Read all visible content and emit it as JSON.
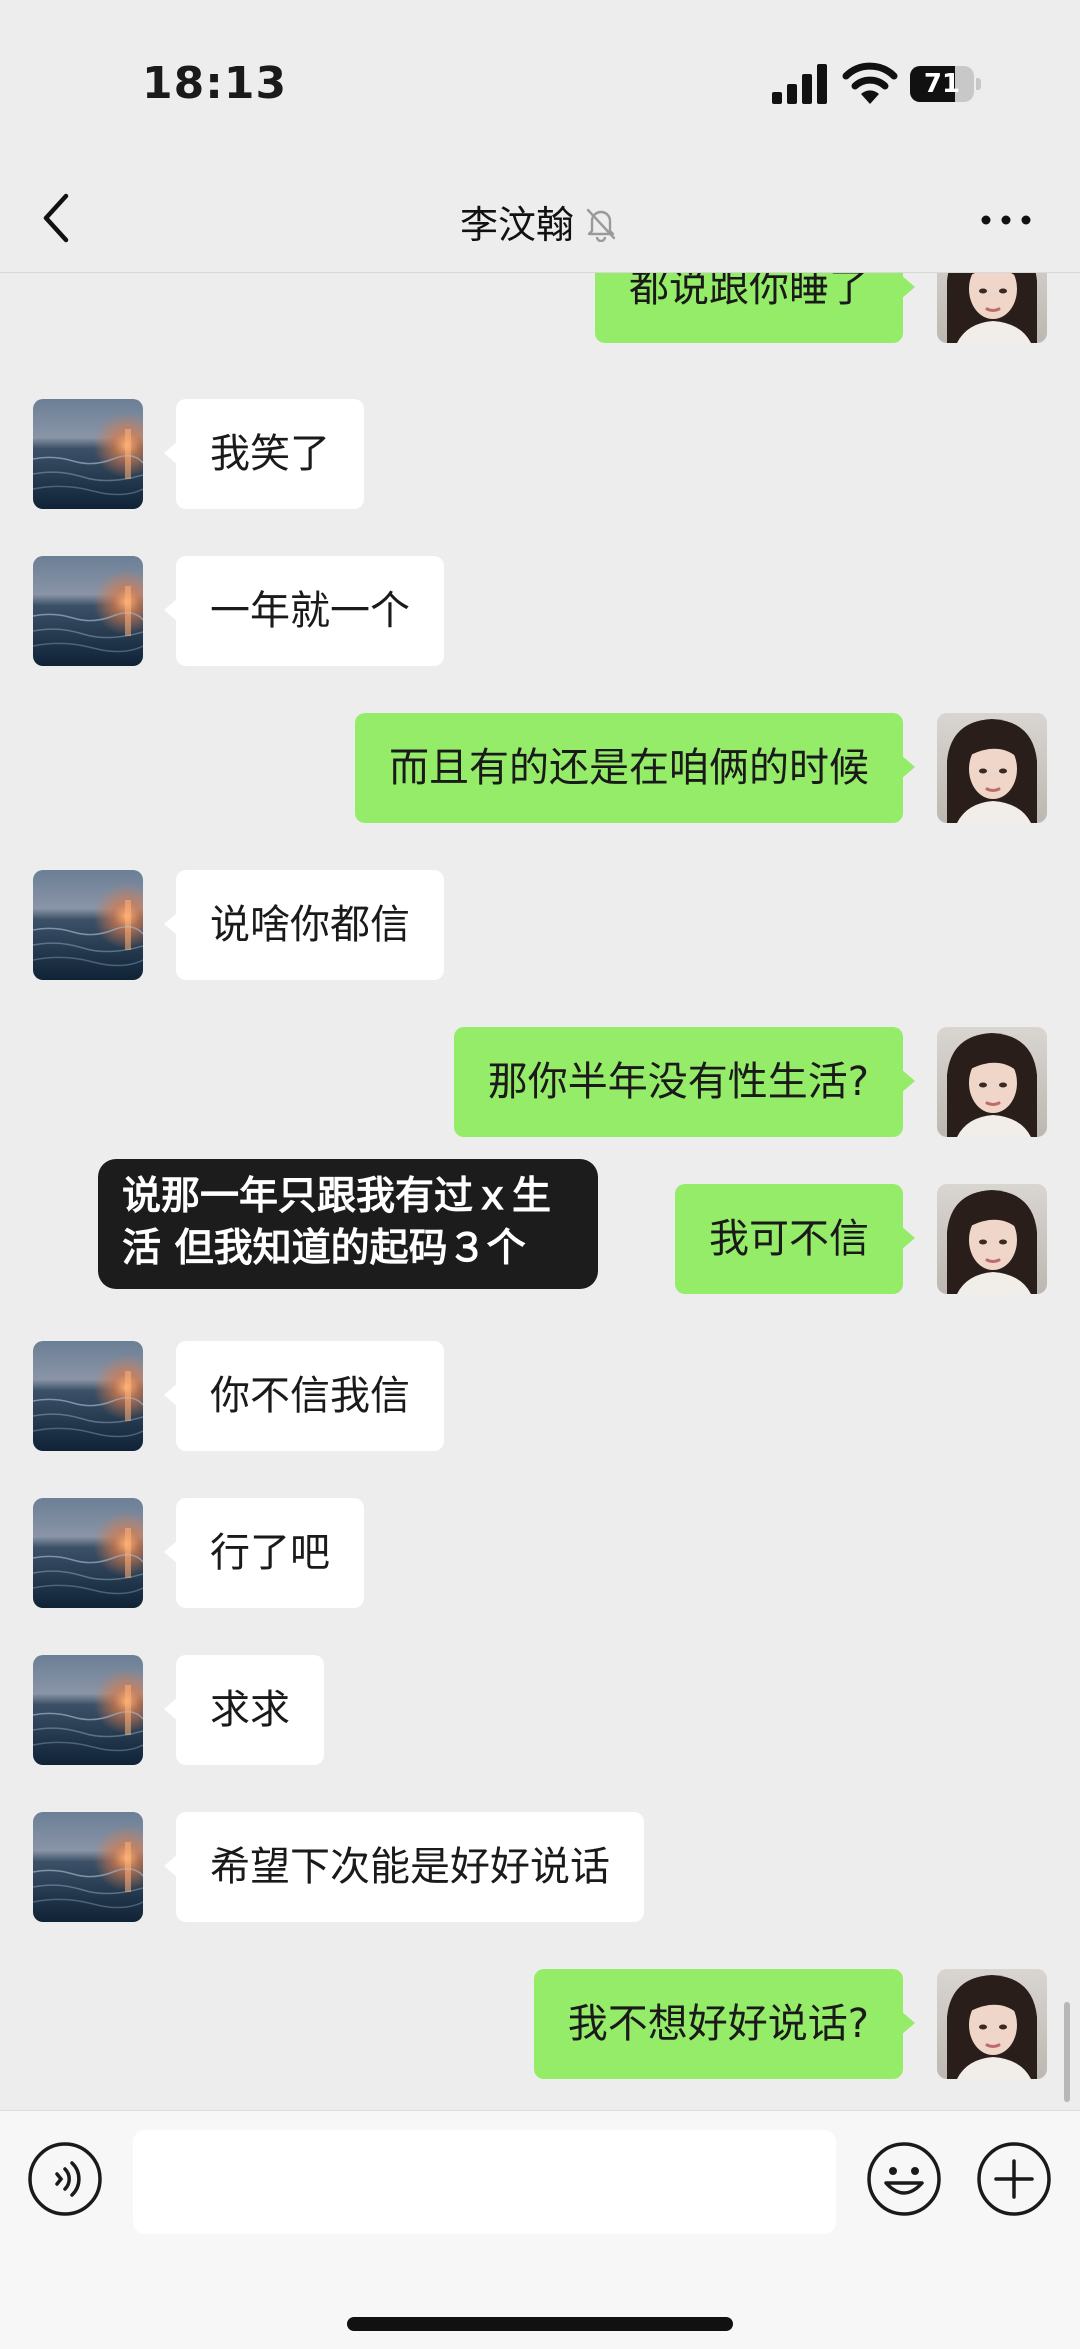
{
  "status_bar": {
    "time": "18:13",
    "battery": "71",
    "battery_level": 0.71
  },
  "header": {
    "contact_name": "李汶翰"
  },
  "messages": [
    {
      "side": "out",
      "text": "都说跟你睡了"
    },
    {
      "side": "in",
      "text": "我笑了"
    },
    {
      "side": "in",
      "text": "一年就一个"
    },
    {
      "side": "out",
      "text": "而且有的还是在咱俩的时候"
    },
    {
      "side": "in",
      "text": "说啥你都信"
    },
    {
      "side": "out",
      "text": "那你半年没有性生活?"
    },
    {
      "side": "out",
      "text": "我可不信"
    },
    {
      "side": "in",
      "text": "你不信我信"
    },
    {
      "side": "in",
      "text": "行了吧"
    },
    {
      "side": "in",
      "text": "求求"
    },
    {
      "side": "in",
      "text": "希望下次能是好好说话"
    },
    {
      "side": "out",
      "text": "我不想好好说话?"
    }
  ],
  "caption": {
    "text": "说那一年只跟我有过ｘ生活 但我知道的起码３个"
  },
  "colors": {
    "outgoing_bubble": "#95ec69",
    "incoming_bubble": "#ffffff",
    "background": "#ededed"
  },
  "icons": {
    "back": "chevron-left-icon",
    "mute": "bell-slash-icon",
    "more": "more-dots-icon",
    "voice": "voice-icon",
    "emoji": "emoji-icon",
    "plus": "plus-icon"
  }
}
